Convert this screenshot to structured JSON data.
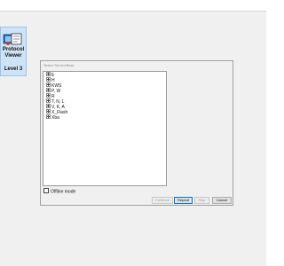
{
  "app_tile": {
    "line1": "Protocol",
    "line2": "Viewer",
    "level": "Level 3",
    "icon": "protocol-viewer-icon"
  },
  "dialog": {
    "title": "Select ServiceBase",
    "tree_items": [
      "E",
      "H",
      "KWS",
      "P, W",
      "R",
      "T, N, L",
      "V, K, A",
      "X_Flash",
      "Xba"
    ],
    "offline_label": "Offline mode",
    "buttons": {
      "continue": "Continue",
      "repeat": "Repeat",
      "skip": "Skip",
      "cancel": "Cancel"
    }
  },
  "colors": {
    "desktop": "#f0f0f0",
    "tile_background": "#cfe3f7",
    "tile_border": "#9cc2e8",
    "default_button_border": "#0078d7"
  }
}
